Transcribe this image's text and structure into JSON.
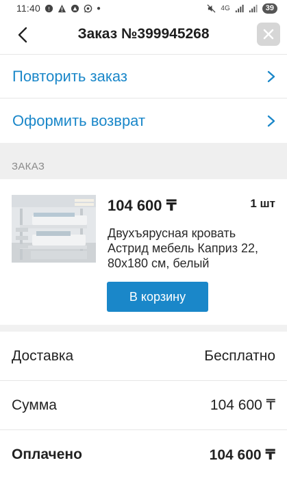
{
  "status_bar": {
    "time": "11:40",
    "network": "4G",
    "battery": "39"
  },
  "header": {
    "title": "Заказ №399945268"
  },
  "actions": {
    "repeat_label": "Повторить заказ",
    "return_label": "Оформить возврат"
  },
  "order_section": {
    "title": "ЗАКАЗ"
  },
  "product": {
    "price": "104 600 ₸",
    "quantity": "1 шт",
    "name": "Двухъярусная кровать Астрид мебель Каприз 22, 80x180 см, белый",
    "cart_button_label": "В корзину"
  },
  "summary": {
    "delivery_label": "Доставка",
    "delivery_value": "Бесплатно",
    "sum_label": "Сумма",
    "sum_value": "104 600 ₸",
    "paid_label": "Оплачено",
    "paid_value": "104 600 ₸"
  },
  "colors": {
    "accent": "#1a87c9",
    "section_bg": "#efefef",
    "close_bg": "#d6d6d6"
  }
}
